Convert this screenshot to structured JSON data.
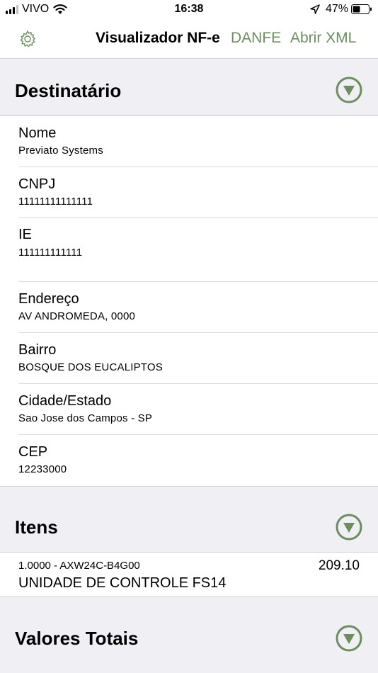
{
  "status": {
    "carrier": "VIVO",
    "time": "16:38",
    "battery": "47%"
  },
  "nav": {
    "title": "Visualizador NF-e",
    "danfe": "DANFE",
    "open_xml": "Abrir XML"
  },
  "destinatario": {
    "title": "Destinatário",
    "fields": [
      {
        "label": "Nome",
        "value": "Previato Systems"
      },
      {
        "label": "CNPJ",
        "value": "11111111111111"
      },
      {
        "label": "IE",
        "value": "111111111111"
      },
      {
        "label": "Endereço",
        "value": "AV ANDROMEDA, 0000"
      },
      {
        "label": "Bairro",
        "value": "BOSQUE DOS EUCALIPTOS"
      },
      {
        "label": "Cidade/Estado",
        "value": "Sao Jose dos Campos - SP"
      },
      {
        "label": "CEP",
        "value": "12233000"
      }
    ]
  },
  "itens": {
    "title": "Itens",
    "items": [
      {
        "code": "1.0000 - AXW24C-B4G00",
        "price": "209.10",
        "name": "UNIDADE DE CONTROLE FS14"
      }
    ]
  },
  "valores": {
    "title": "Valores Totais"
  },
  "colors": {
    "accent": "#6b8e5e",
    "header_bg": "#efeff4"
  }
}
